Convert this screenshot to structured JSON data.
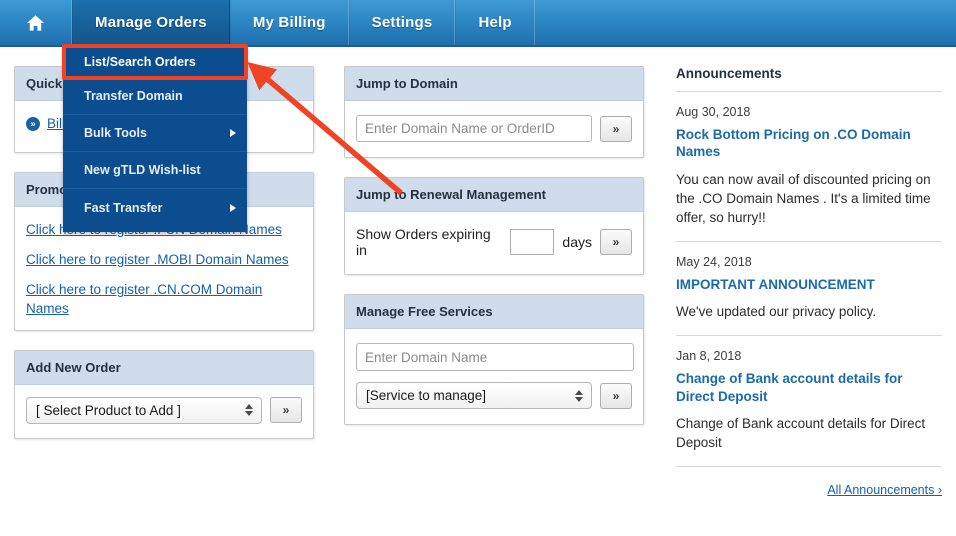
{
  "nav": {
    "items": [
      {
        "label": "",
        "icon": "home-icon",
        "name": "home"
      },
      {
        "label": "Manage Orders",
        "name": "manage-orders"
      },
      {
        "label": "My Billing",
        "name": "my-billing"
      },
      {
        "label": "Settings",
        "name": "settings"
      },
      {
        "label": "Help",
        "name": "help"
      }
    ],
    "active": "Manage Orders"
  },
  "dropdown": {
    "items": [
      {
        "label": "List/Search Orders",
        "submenu": false
      },
      {
        "label": "Transfer Domain",
        "submenu": false
      },
      {
        "label": "Bulk Tools",
        "submenu": true
      },
      {
        "label": "New gTLD Wish-list",
        "submenu": false
      },
      {
        "label": "Fast Transfer",
        "submenu": true
      }
    ]
  },
  "left": {
    "quick": {
      "title": "Quick Links",
      "link": "Billing & Transactions"
    },
    "promo": {
      "title": "Promotions",
      "links": [
        "Click here to register .FUN Domain Names",
        "Click here to register .MOBI Domain Names",
        "Click here to register .CN.COM Domain Names"
      ]
    },
    "add_order": {
      "title": "Add New Order",
      "select_value": "[ Select Product to Add ]",
      "go_label": "»"
    }
  },
  "middle": {
    "jump_domain": {
      "title": "Jump to Domain",
      "placeholder": "Enter Domain Name or OrderID",
      "value": "",
      "go_label": "»"
    },
    "jump_renewal": {
      "title": "Jump to Renewal Management",
      "label_before": "Show Orders expiring in",
      "days_value": "",
      "label_after": "days",
      "go_label": "»"
    },
    "free_services": {
      "title": "Manage Free Services",
      "placeholder": "Enter Domain Name",
      "value": "",
      "select_value": "[Service to manage]",
      "go_label": "»"
    }
  },
  "announcements": {
    "title": "Announcements",
    "items": [
      {
        "date": "Aug 30, 2018",
        "heading": "Rock Bottom Pricing on .CO Domain Names",
        "body": "You can now avail of discounted pricing on the .CO Domain Names . It's a limited time offer, so hurry!!"
      },
      {
        "date": "May 24, 2018",
        "heading": "IMPORTANT ANNOUNCEMENT",
        "body": "We've updated our privacy policy."
      },
      {
        "date": "Jan 8, 2018",
        "heading": "Change of Bank account details for Direct Deposit",
        "body": "Change of Bank account details for Direct Deposit"
      }
    ],
    "all_link": "All Announcements ›"
  },
  "colors": {
    "nav_blue": "#2d87c4",
    "nav_active": "#12558c",
    "dropdown_blue": "#0b4d8f",
    "panel_header": "#cfdcec",
    "link_blue": "#1560a8",
    "annotation_red": "#ef4323"
  }
}
